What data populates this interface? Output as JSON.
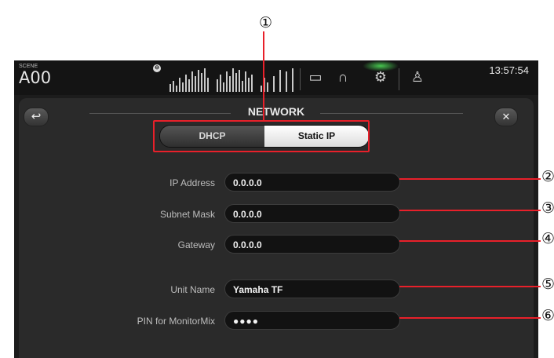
{
  "callouts": [
    "①",
    "②",
    "③",
    "④",
    "⑤",
    "⑥"
  ],
  "topbar": {
    "scene_label": "SCENE",
    "scene_number": "A00",
    "meter_badge": "⊖",
    "time": "13:57:54",
    "icons": [
      "meter-icon",
      "monitor-icon",
      "headphones-icon",
      "gear-icon",
      "user-icon"
    ]
  },
  "panel": {
    "title": "NETWORK",
    "back_icon": "↩",
    "close_icon": "✕",
    "mode": {
      "options": [
        "DHCP",
        "Static IP"
      ],
      "selected": "Static IP"
    },
    "fields": [
      {
        "label": "IP Address",
        "value": "0.0.0.0"
      },
      {
        "label": "Subnet Mask",
        "value": "0.0.0.0"
      },
      {
        "label": "Gateway",
        "value": "0.0.0.0"
      },
      {
        "label": "Unit Name",
        "value": "Yamaha TF"
      },
      {
        "label": "PIN for MonitorMix",
        "value": "●●●●"
      }
    ]
  },
  "colors": {
    "callout_red": "#e8202a",
    "glow_green": "#50e65a"
  }
}
